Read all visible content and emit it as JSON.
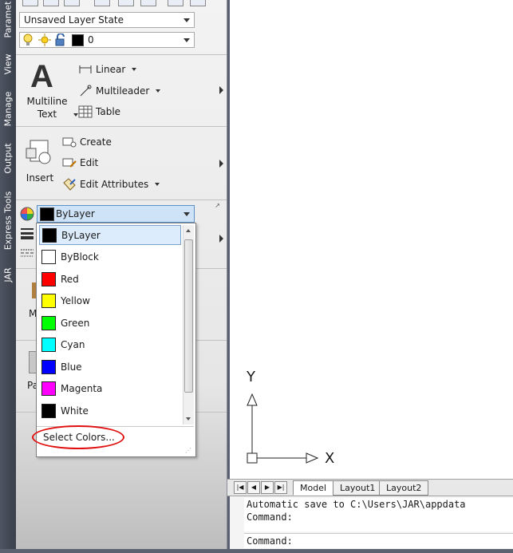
{
  "vertical_tabs": [
    "Paramet",
    "View",
    "Manage",
    "Output",
    "Express Tools",
    "JAR"
  ],
  "layers": {
    "layer_state": "Unsaved Layer State",
    "current_layer": "0"
  },
  "annotation": {
    "multiline_text_line1": "Multiline",
    "multiline_text_line2": "Text",
    "linear": "Linear",
    "multileader": "Multileader",
    "table": "Table"
  },
  "block": {
    "insert": "Insert",
    "create": "Create",
    "edit": "Edit",
    "edit_attributes": "Edit Attributes"
  },
  "properties": {
    "color_value": "ByLayer",
    "partial_label_1": "M",
    "partial_label_2": "Pa"
  },
  "color_dropdown": {
    "items": [
      {
        "label": "ByLayer",
        "color": "#000000"
      },
      {
        "label": "ByBlock",
        "color": "#ffffff"
      },
      {
        "label": "Red",
        "color": "#ff0000"
      },
      {
        "label": "Yellow",
        "color": "#ffff00"
      },
      {
        "label": "Green",
        "color": "#00ff00"
      },
      {
        "label": "Cyan",
        "color": "#00ffff"
      },
      {
        "label": "Blue",
        "color": "#0000ff"
      },
      {
        "label": "Magenta",
        "color": "#ff00ff"
      },
      {
        "label": "White",
        "color": "#000000"
      }
    ],
    "selected": "ByLayer",
    "select_colors": "Select Colors..."
  },
  "ucs": {
    "x_label": "X",
    "y_label": "Y"
  },
  "layout_tabs": [
    "Model",
    "Layout1",
    "Layout2"
  ],
  "command": {
    "line1": "Automatic save to C:\\Users\\JAR\\appdata",
    "line2": "Command:",
    "input": "Command:"
  },
  "colors": {
    "highlight": "#dcecfc",
    "annotation_circle": "#e01010"
  }
}
